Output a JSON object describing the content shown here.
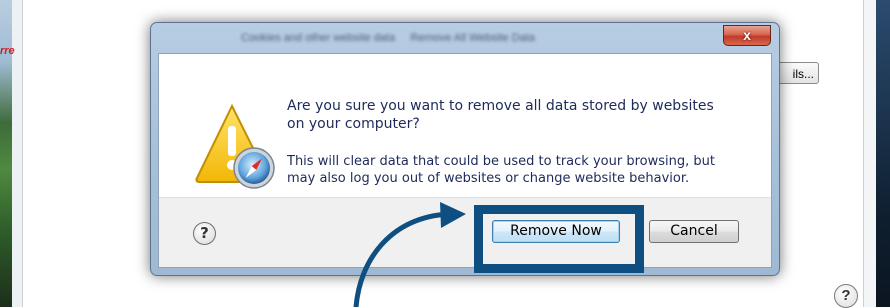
{
  "background": {
    "left_fragment_text": "rre",
    "details_button_label": "ils...",
    "bottom_partial_text": "~~ ~~~~~ ~~~~ ~~~~~~~~~",
    "help_icon_glyph": "?"
  },
  "dialog": {
    "title": "Cookies and other website data",
    "title_tab": "Remove All Website Data",
    "close_glyph": "x",
    "message_main": "Are you sure you want to remove all data stored by websites on your computer?",
    "message_sub": "This will clear data that could be used to track your browsing, but may also log you out of websites or change website behavior.",
    "help_glyph": "?",
    "buttons": {
      "remove_now": "Remove Now",
      "cancel": "Cancel"
    },
    "icon": "warning-safari-icon"
  },
  "annotation": {
    "highlight_color": "#0e4e80",
    "arrow_color": "#0e4e80"
  }
}
